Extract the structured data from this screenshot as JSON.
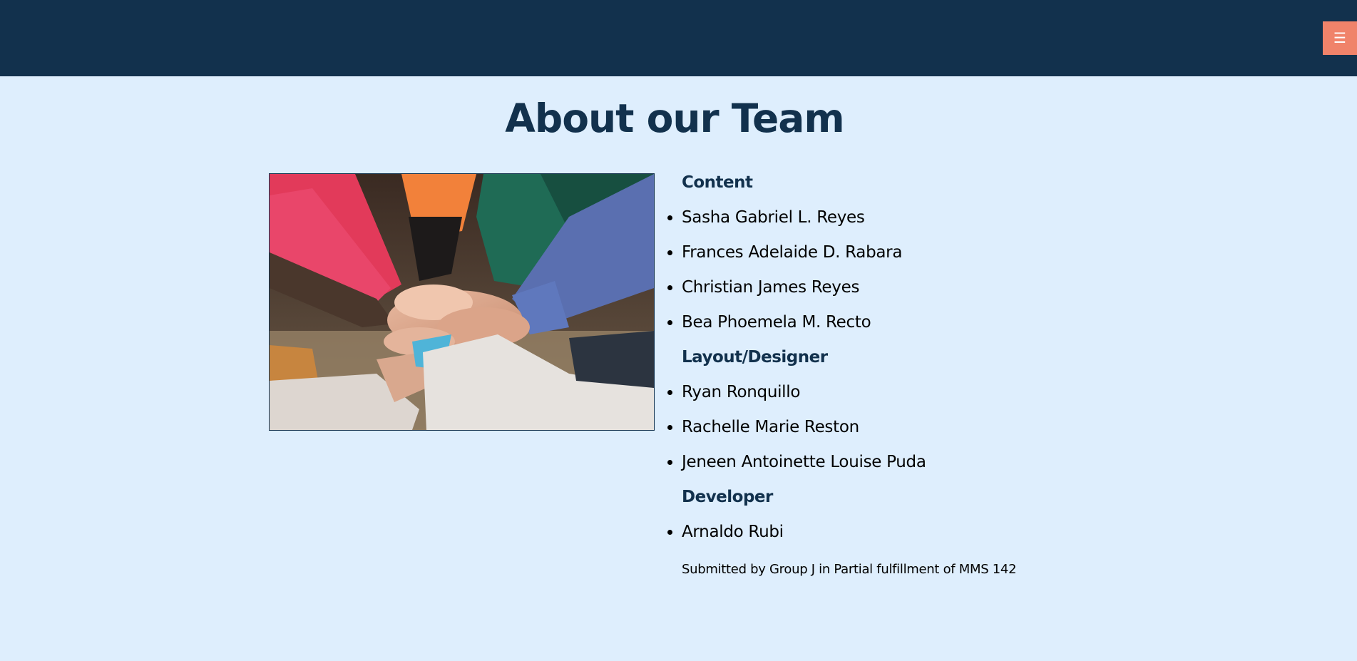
{
  "header": {
    "menu_icon": "hamburger-icon",
    "menu_glyph": "☰",
    "background": "#12314d",
    "accent": "#f0836a"
  },
  "page": {
    "title": "About our Team",
    "background": "#deeefd"
  },
  "team": {
    "groups": [
      {
        "role": "Content",
        "members": [
          "Sasha Gabriel L. Reyes",
          "Frances Adelaide D. Rabara",
          "Christian James Reyes",
          "Bea Phoemela M. Recto"
        ]
      },
      {
        "role": "Layout/Designer",
        "members": [
          "Ryan Ronquillo",
          "Rachelle Marie Reston",
          "Jeneen Antoinette Louise Puda"
        ]
      },
      {
        "role": "Developer",
        "members": [
          "Arnaldo Rubi"
        ]
      }
    ],
    "footnote": "Submitted by Group J in Partial fulfillment of MMS 142"
  }
}
